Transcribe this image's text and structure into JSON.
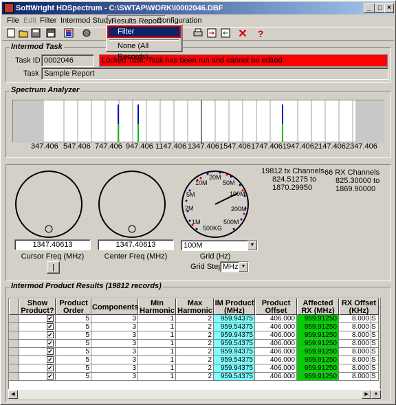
{
  "window": {
    "title": "SoftWright HDSpectrum - C:\\SWTAP\\WORK\\I0002046.DBF",
    "buttons": {
      "minimize": "_",
      "maximize": "□",
      "close": "×"
    }
  },
  "menubar": {
    "items": [
      "File",
      "Edit",
      "Filter",
      "Intermod Study",
      "Results Report",
      "Configuration"
    ]
  },
  "dropdown": {
    "items": [
      "Filter",
      "None (All Records)"
    ]
  },
  "toolbar": {
    "icons": [
      "new-icon",
      "open-icon",
      "save-icon",
      "save-as-icon",
      "report-icon",
      "tools-icon",
      "print-icon",
      "export-icon",
      "import-icon",
      "delete-icon",
      "help-icon"
    ],
    "delete_glyph": "✕",
    "help_glyph": "?"
  },
  "intermod_task": {
    "title": "Intermod Task",
    "task_id_label": "Task ID:",
    "task_id": "0002046",
    "locked_msg": "Locked Task, Task has been run and cannot be edited.",
    "task_label": "Task",
    "task_name": "Sample Report"
  },
  "spectrum": {
    "title": "Spectrum Analyzer",
    "ticks": [
      "347.406",
      "547.406",
      "747.406",
      "947.406",
      "1147.406",
      "1347.406",
      "1547.406",
      "1747.406",
      "1947.406",
      "2147.406",
      "2347.406"
    ]
  },
  "dials": {
    "cursor_freq": "1347.40613",
    "cursor_label": "Cursor Freq (MHz)",
    "center_freq": "1347.40613",
    "center_label": "Center Freq (MHz)",
    "grid_value": "100M",
    "grid_label": "Grid (Hz)",
    "grid_step_label": "Grid Step",
    "grid_step_value": "MHz",
    "dial_marks": [
      "10M",
      "20M",
      "50M",
      "100M",
      "200M",
      "500M",
      "500KG",
      "1M",
      "2M",
      "5M"
    ],
    "small_button": "|"
  },
  "channels": {
    "tx_title": "19812 tx Channels",
    "tx_from": "824.51275 to",
    "tx_to": "1870.29950",
    "rx_title": "66 RX Channels",
    "rx_from": "825.30000 to",
    "rx_to": "1869.90000"
  },
  "results": {
    "title": "Intermod Product Results (19812 records)",
    "columns": [
      "Show Product?",
      "Product Order",
      "Components",
      "Min Harmonic",
      "Max Harmonic",
      "IM Product (MHz)",
      "Product Offset",
      "Affected RX (MHz)",
      "RX Offset (KHz)"
    ],
    "rows": [
      [
        "✔",
        "5",
        "3",
        "1",
        "2",
        "959.94375",
        "406.000",
        "959.91250",
        "8.000",
        "S"
      ],
      [
        "✔",
        "5",
        "3",
        "1",
        "2",
        "959.54375",
        "406.000",
        "959.91250",
        "8.000",
        "S"
      ],
      [
        "✔",
        "5",
        "3",
        "1",
        "2",
        "959.94375",
        "406.000",
        "959.91250",
        "8.000",
        "S"
      ],
      [
        "✔",
        "5",
        "3",
        "1",
        "2",
        "959.54375",
        "406.000",
        "959.91250",
        "8.000",
        "S"
      ],
      [
        "✔",
        "5",
        "3",
        "1",
        "2",
        "959.94375",
        "406.000",
        "959.91250",
        "8.000",
        "S"
      ],
      [
        "✔",
        "5",
        "3",
        "1",
        "2",
        "959.54375",
        "406.000",
        "959.91250",
        "8.000",
        "S"
      ],
      [
        "✔",
        "5",
        "3",
        "1",
        "2",
        "959.94375",
        "406.000",
        "959.91250",
        "8.000",
        "S"
      ],
      [
        "✔",
        "5",
        "3",
        "1",
        "2",
        "959.54375",
        "406.000",
        "959.91250",
        "8.000",
        "S"
      ]
    ]
  },
  "colors": {
    "title_start": "#0a246a",
    "locked_bg": "#ff0000",
    "cyan_cell": "#7fffff",
    "green_cell": "#00d000",
    "spectrum_blue": "#0000c0",
    "spectrum_green": "#00c000"
  }
}
